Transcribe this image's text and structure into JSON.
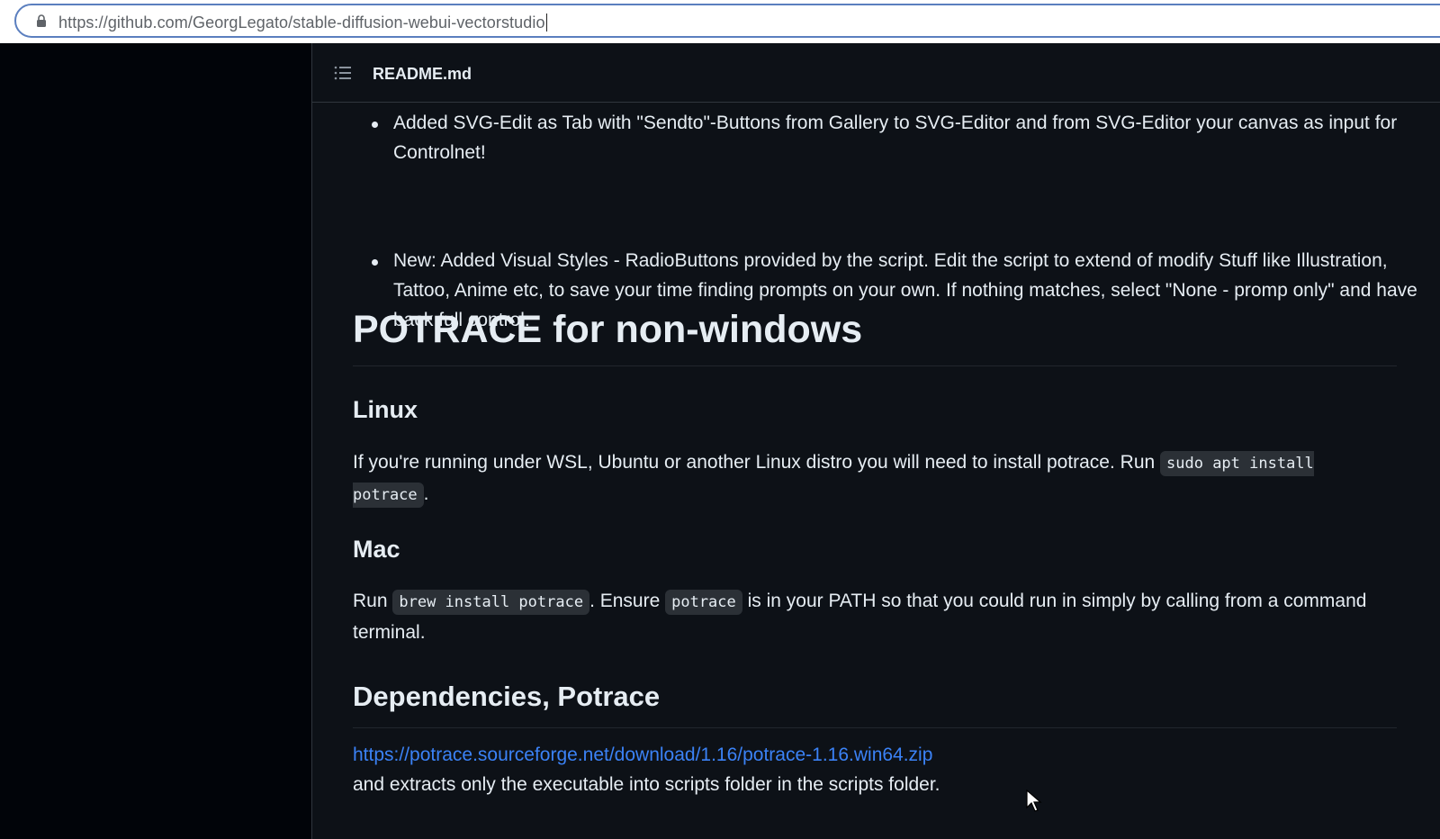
{
  "browser": {
    "url": "https://github.com/GeorgLegato/stable-diffusion-webui-vectorstudio",
    "lock_icon": "lock-icon"
  },
  "readme": {
    "title": "README.md",
    "toc_icon": "list-icon"
  },
  "bullets": [
    "Added SVG-Edit as Tab with \"Sendto\"-Buttons from Gallery to SVG-Editor and from SVG-Editor your canvas as input for Controlnet!",
    "New: Added Visual Styles - RadioButtons provided by the script. Edit the script to extend of modify Stuff like Illustration, Tattoo, Anime etc, to save your time finding prompts on your own. If nothing matches, select \"None - promp only\" and have back full control."
  ],
  "section": {
    "heading": "POTRACE for non-windows",
    "linux": {
      "heading": "Linux",
      "text": "If you're running under WSL, Ubuntu or another Linux distro you will need to install potrace. Run ",
      "code": "sudo apt install potrace",
      "after": "."
    },
    "mac": {
      "heading": "Mac",
      "run": "Run ",
      "code1": "brew install potrace",
      "mid": ". Ensure ",
      "code2": "potrace",
      "rest": " is in your PATH so that you could run in simply by calling from a command terminal."
    }
  },
  "dependencies": {
    "heading": "Dependencies, Potrace",
    "link": "https://potrace.sourceforge.net/download/1.16/potrace-1.16.win64.zip",
    "text": "and extracts only the executable into scripts folder in the scripts folder."
  },
  "colors": {
    "background": "#0d1117",
    "text": "#e6edf3",
    "link": "#3b82f6",
    "code_bg": "#2b3036"
  }
}
